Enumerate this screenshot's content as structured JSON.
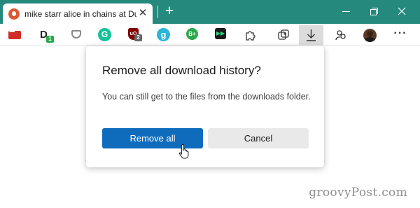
{
  "browser": {
    "tab": {
      "title": "mike starr alice in chains at Duck",
      "close_glyph": "✕",
      "favicon": "duckduckgo-icon"
    },
    "new_tab_glyph": "+",
    "theme_color": "#258a7d",
    "window_controls": [
      "minimize-icon",
      "restore-icon",
      "close-icon"
    ]
  },
  "toolbar": {
    "extensions": [
      {
        "name": "lastpass-icon"
      },
      {
        "name": "dashlane-icon",
        "glyph": "D",
        "badge": "1",
        "badge_color": "#2ba84a"
      },
      {
        "name": "pocket-icon"
      },
      {
        "name": "grammarly-icon",
        "glyph": "G"
      },
      {
        "name": "ublock-icon",
        "glyph": "uO",
        "badge": "2",
        "badge_color": "#666666"
      },
      {
        "name": "g-extension-icon",
        "glyph": "g"
      },
      {
        "name": "bplus-extension-icon",
        "glyph": "B+"
      },
      {
        "name": "fast-forward-extension-icon",
        "glyph": "▶▶"
      }
    ],
    "buttons": [
      "extensions-puzzle-icon",
      "collections-icon",
      "downloads-icon",
      "profiles-icon",
      "avatar",
      "more-icon"
    ],
    "more_glyph": "···"
  },
  "dialog": {
    "title": "Remove all download history?",
    "body": "You can still get to the files from the downloads folder.",
    "primary_label": "Remove all",
    "secondary_label": "Cancel",
    "primary_color": "#0f6cbd"
  },
  "watermark": "groovyPost.com"
}
